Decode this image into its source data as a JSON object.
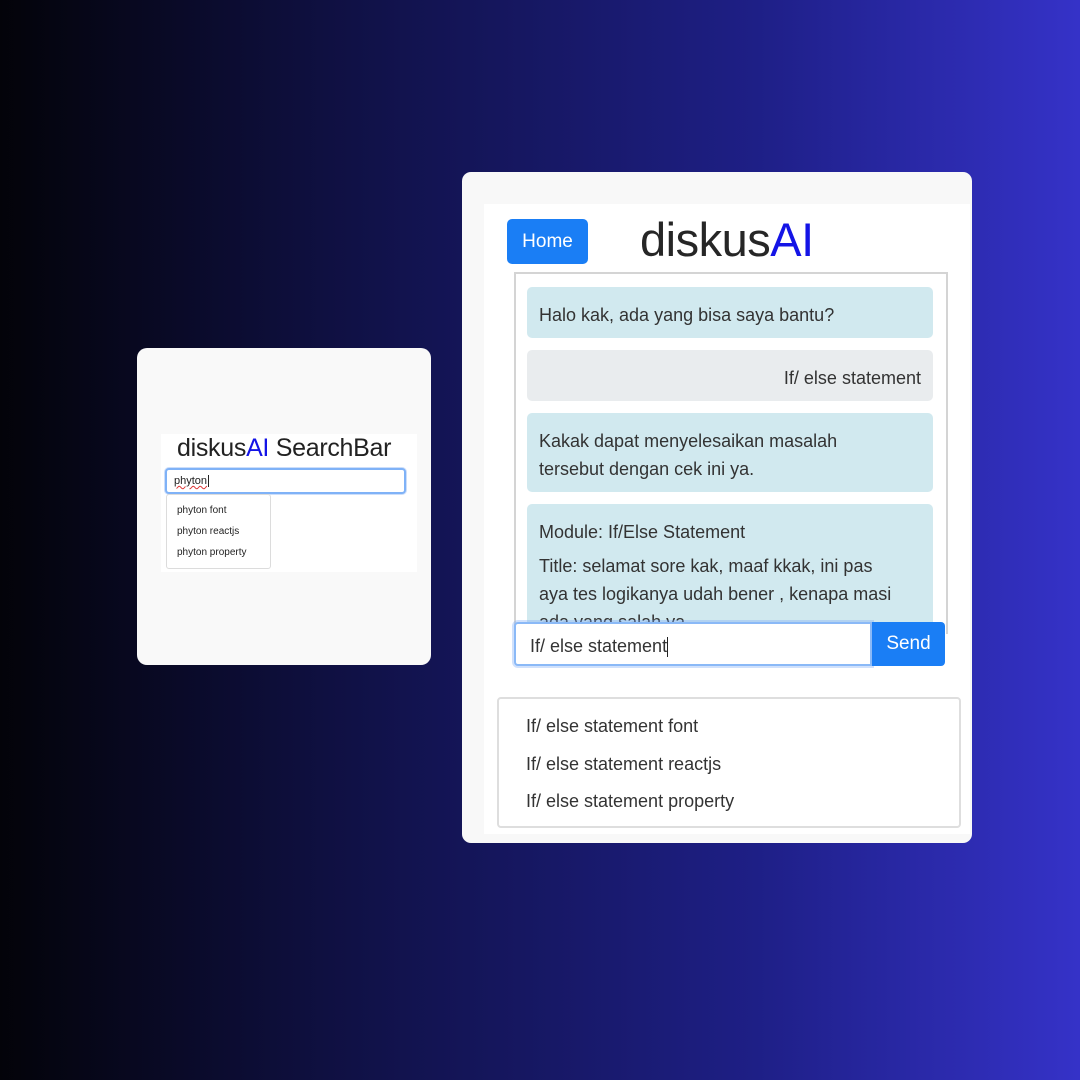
{
  "searchbar_card": {
    "title_prefix": "diskus",
    "title_accent": "AI",
    "title_suffix": " SearchBar",
    "search_value": "phyton",
    "suggestions": [
      "phyton font",
      "phyton reactjs",
      "phyton property"
    ]
  },
  "chat_card": {
    "home_label": "Home",
    "title_prefix": "diskus",
    "title_accent": "AI",
    "messages": [
      {
        "role": "bot",
        "lines": [
          "Halo kak, ada yang bisa saya bantu?"
        ]
      },
      {
        "role": "user",
        "lines": [
          "If/ else statement"
        ]
      },
      {
        "role": "bot",
        "lines": [
          "Kakak dapat menyelesaikan masalah",
          "tersebut dengan cek ini ya."
        ]
      },
      {
        "role": "bot",
        "lines": [
          "Module: If/Else Statement",
          "Title: selamat sore kak, maaf kkak, ini pas",
          "aya tes logikanya udah bener , kenapa masi",
          "ada yang salah ya"
        ]
      }
    ],
    "input_value": "If/ else statement",
    "send_label": "Send",
    "suggestions": [
      "If/ else statement font",
      "If/ else statement reactjs",
      "If/ else statement property"
    ]
  },
  "colors": {
    "accent_blue": "#1a7ef5",
    "brand_ai": "#1414e6",
    "bot_bubble": "#d1e9ef",
    "user_bubble": "#e9ecee"
  }
}
